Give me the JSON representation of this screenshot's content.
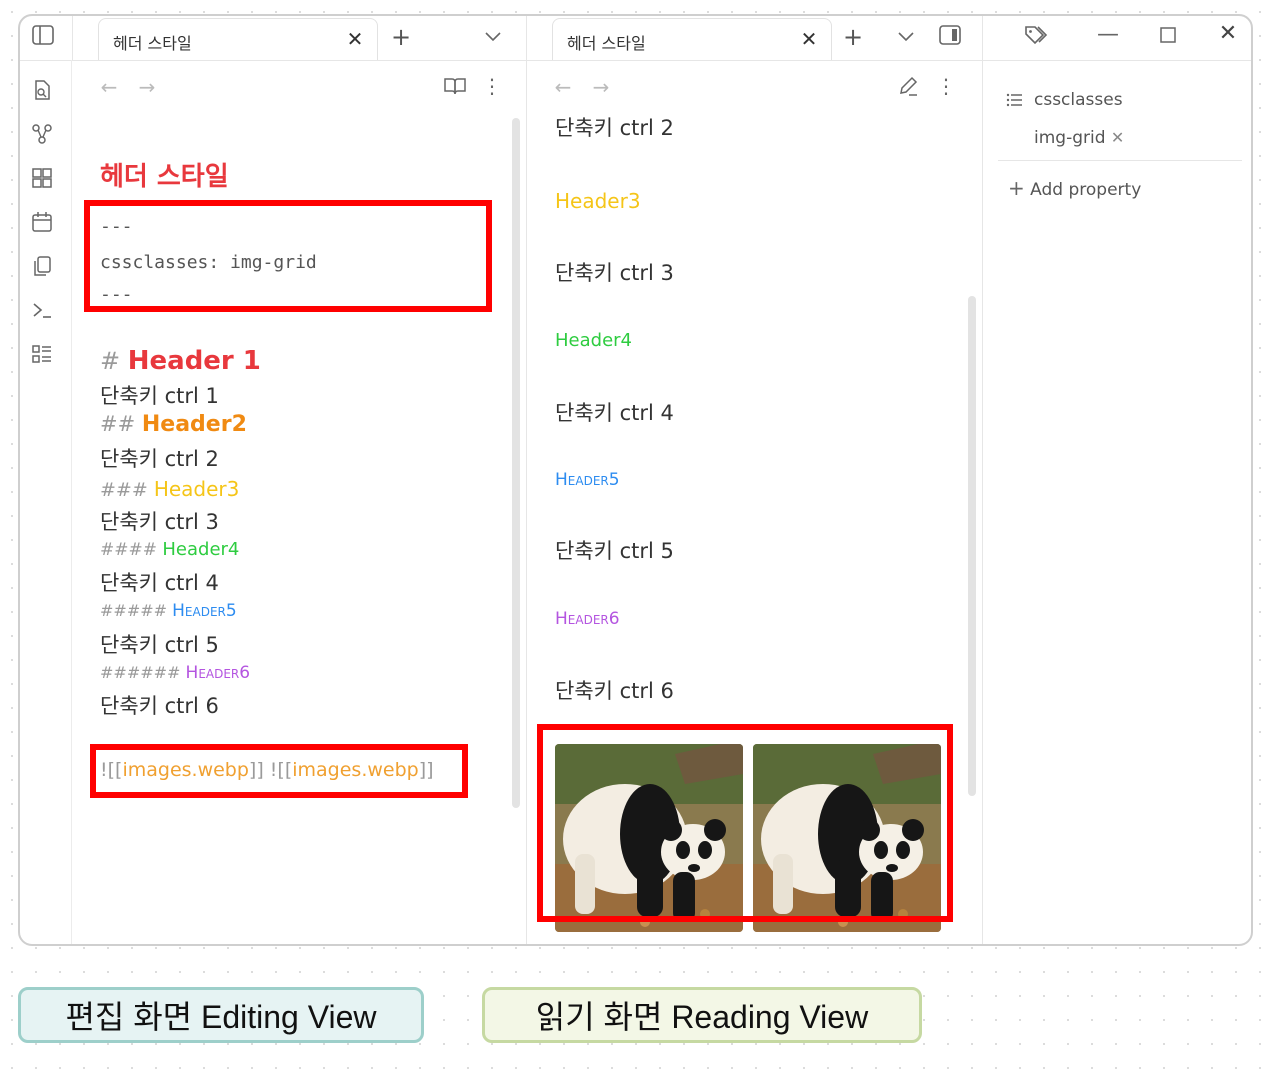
{
  "left_pane": {
    "tab_title": "헤더 스타일",
    "note_title": "헤더 스타일",
    "frontmatter": {
      "open": "---",
      "line": "cssclasses: img-grid",
      "close": "---"
    },
    "lines": [
      {
        "prefix": "# ",
        "text": "Header 1"
      },
      {
        "text": "단축키 ctrl 1"
      },
      {
        "prefix": "## ",
        "text": "Header2"
      },
      {
        "text": "단축키 ctrl 2"
      },
      {
        "prefix": "### ",
        "text": "Header3"
      },
      {
        "text": "단축키 ctrl 3"
      },
      {
        "prefix": "#### ",
        "text": "Header4"
      },
      {
        "text": "단축키 ctrl 4"
      },
      {
        "prefix": "##### ",
        "text": "Header5"
      },
      {
        "text": "단축키 ctrl 5"
      },
      {
        "prefix": "###### ",
        "text": "Header6"
      },
      {
        "text": "단축키 ctrl 6"
      }
    ],
    "embed": {
      "bang": "![[",
      "name": "images.webp",
      "close": "]]"
    }
  },
  "right_pane": {
    "tab_title": "헤더 스타일",
    "lines": [
      {
        "text": "단축키 ctrl 2"
      },
      {
        "text": "Header3"
      },
      {
        "text": "단축키 ctrl 3"
      },
      {
        "text": "Header4"
      },
      {
        "text": "단축키 ctrl 4"
      },
      {
        "text": "Header5"
      },
      {
        "text": "단축키 ctrl 5"
      },
      {
        "text": "Header6"
      },
      {
        "text": "단축키 ctrl 6"
      }
    ]
  },
  "properties": {
    "name": "cssclasses",
    "value": "img-grid",
    "add_label": "Add property"
  },
  "captions": {
    "editing": "편집 화면 Editing View",
    "reading": "읽기 화면 Reading View"
  },
  "colors": {
    "h1": "#e8383d",
    "h2": "#f08a12",
    "h3": "#f5c518",
    "h4": "#2ecc40",
    "h5": "#2d8cf0",
    "h6": "#b455e0",
    "highlight": "#ff0000",
    "caption_editing_bg": "#e6f3f3",
    "caption_editing_border": "#9dcfca",
    "caption_reading_bg": "#f3f7e6",
    "caption_reading_border": "#c6d9a2"
  }
}
